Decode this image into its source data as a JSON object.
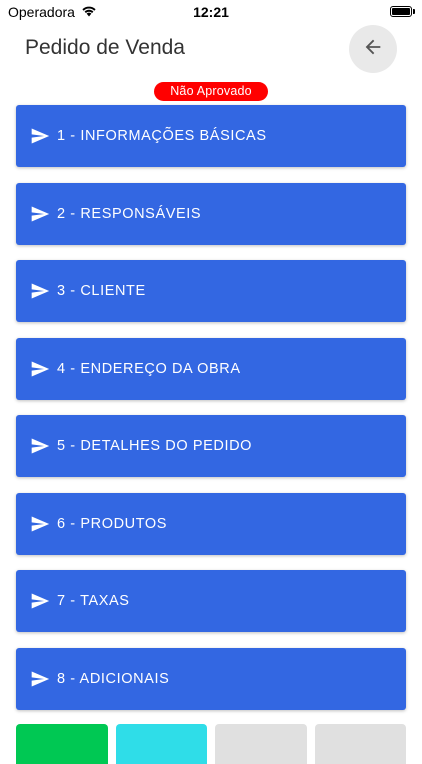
{
  "status_bar": {
    "carrier": "Operadora",
    "time": "12:21"
  },
  "header": {
    "title": "Pedido de Venda",
    "back_icon": "arrow-left-icon"
  },
  "status_badge": {
    "label": "Não Aprovado",
    "color": "#ff0000"
  },
  "menu": {
    "icon": "send-icon",
    "color": "#3367e2",
    "items": [
      {
        "label": "1 - INFORMAÇÕES BÁSICAS"
      },
      {
        "label": "2 - RESPONSÁVEIS"
      },
      {
        "label": "3 - CLIENTE"
      },
      {
        "label": "4 - ENDEREÇO DA OBRA"
      },
      {
        "label": "5 - DETALHES DO PEDIDO"
      },
      {
        "label": "6 - PRODUTOS"
      },
      {
        "label": "7 - TAXAS"
      },
      {
        "label": "8 - ADICIONAIS"
      }
    ]
  },
  "bottom_buttons": [
    {
      "color": "#00c853"
    },
    {
      "color": "#2fdde8"
    },
    {
      "color": "#e0e0e0"
    },
    {
      "color": "#e0e0e0"
    }
  ]
}
